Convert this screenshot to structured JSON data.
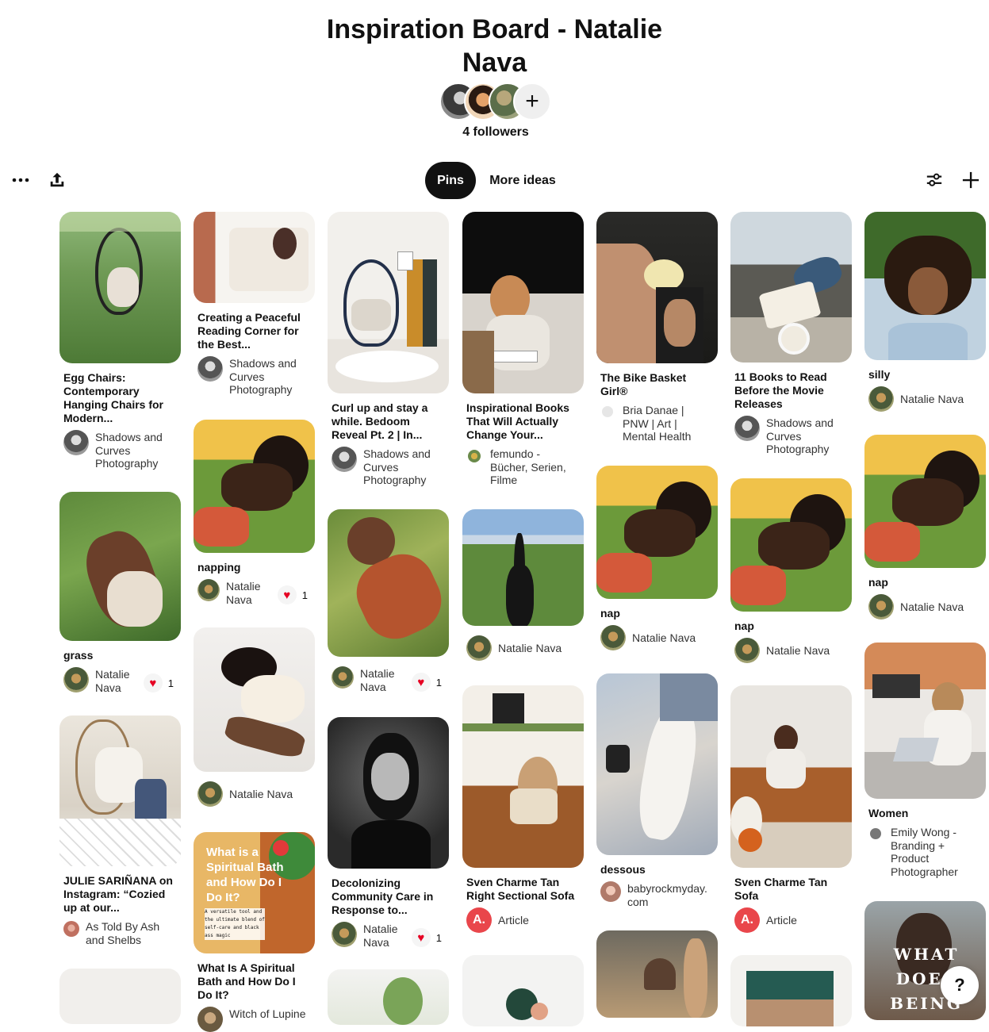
{
  "board": {
    "title": "Inspiration Board - Natalie Nava",
    "followers": "4 followers",
    "add_collaborator_symbol": "+"
  },
  "tabs": {
    "pins": "Pins",
    "more_ideas": "More ideas"
  },
  "toolbar": {
    "more_icon": "ellipsis-icon",
    "share_icon": "share-upload-icon",
    "filter_icon": "filter-sliders-icon",
    "add_icon": "plus-icon"
  },
  "pins": {
    "c1": [
      {
        "title": "Egg Chairs: Contemporary Hanging Chairs for Modern...",
        "author": "Shadows and Curves Photography"
      },
      {
        "title": "grass",
        "author": "Natalie Nava",
        "likes": "1"
      },
      {
        "title": "JULIE SARIÑANA on Instagram: “Cozied up at our...",
        "author": "As Told By Ash and Shelbs"
      }
    ],
    "c2": [
      {
        "title": "Creating a Peaceful Reading Corner for the Best...",
        "author": "Shadows and Curves Photography"
      },
      {
        "title": "napping",
        "author": "Natalie Nava",
        "likes": "1"
      },
      {
        "title": "",
        "author": "Natalie Nava"
      },
      {
        "title": "What Is A Spiritual Bath and How Do I Do It?",
        "author": "Witch of Lupine",
        "overlay": "What is a Spiritual Bath and How Do I Do It?",
        "overlay_small": "A versatile tool and the ultimate blend of self-care and black ass magic"
      }
    ],
    "c3": [
      {
        "title": "Curl up and stay a while. Bedoom Reveal Pt. 2 | In...",
        "author": "Shadows and Curves Photography"
      },
      {
        "title": "",
        "author": "Natalie Nava",
        "likes": "1"
      },
      {
        "title": "Decolonizing Community Care in Response to...",
        "author": "Natalie Nava",
        "likes": "1"
      }
    ],
    "c4": [
      {
        "title": "Inspirational Books That Will Actually Change Your...",
        "author": "femundo - Bücher, Serien, Filme"
      },
      {
        "title": "",
        "author": "Natalie Nava"
      },
      {
        "title": "Sven Charme Tan Right Sectional Sofa",
        "author": "Article",
        "avatar_letter": "A."
      }
    ],
    "c5": [
      {
        "title": "The Bike Basket Girl®",
        "author": "Bria Danae | PNW | Art | Mental Health"
      },
      {
        "title": "nap",
        "author": "Natalie Nava"
      },
      {
        "title": "dessous",
        "author": "babyrockmyday. com"
      }
    ],
    "c6": [
      {
        "title": "11 Books to Read Before the Movie Releases",
        "author": "Shadows and Curves Photography"
      },
      {
        "title": "nap",
        "author": "Natalie Nava"
      },
      {
        "title": "Sven Charme Tan Sofa",
        "author": "Article",
        "avatar_letter": "A."
      }
    ],
    "c7": [
      {
        "title": "silly",
        "author": "Natalie Nava"
      },
      {
        "title": "nap",
        "author": "Natalie Nava"
      },
      {
        "title": "Women",
        "author": "Emily Wong - Branding + Product Photographer"
      },
      {
        "title": "",
        "author": "",
        "overlay": "WHAT DOES BEING WELL MEAN"
      }
    ]
  },
  "help": "?"
}
